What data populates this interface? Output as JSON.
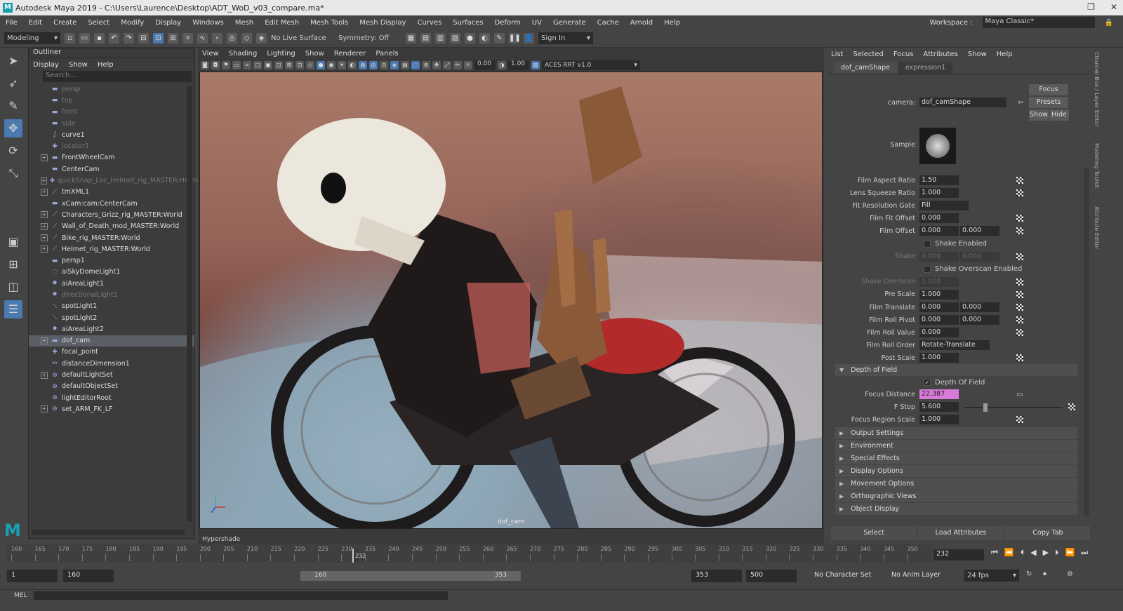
{
  "window": {
    "title": "Autodesk Maya 2019 - C:\\Users\\Laurence\\Desktop\\ADT_WoD_v03_compare.ma*"
  },
  "menu": [
    "File",
    "Edit",
    "Create",
    "Select",
    "Modify",
    "Display",
    "Windows",
    "Mesh",
    "Edit Mesh",
    "Mesh Tools",
    "Mesh Display",
    "Curves",
    "Surfaces",
    "Deform",
    "UV",
    "Generate",
    "Cache",
    "Arnold",
    "Help"
  ],
  "workspace": {
    "label": "Workspace :",
    "value": "Maya Classic*"
  },
  "statusline": {
    "mode": "Modeling",
    "live_surface": "No Live Surface",
    "symmetry": "Symmetry: Off",
    "sign_in": "Sign In"
  },
  "outliner": {
    "title": "Outliner",
    "menu": [
      "Display",
      "Show",
      "Help"
    ],
    "search_placeholder": "Search...",
    "items": [
      {
        "label": "persp",
        "dim": true,
        "exp": false,
        "icon": "camera-icon"
      },
      {
        "label": "top",
        "dim": true,
        "exp": false,
        "icon": "camera-icon"
      },
      {
        "label": "front",
        "dim": true,
        "exp": false,
        "icon": "camera-icon"
      },
      {
        "label": "side",
        "dim": true,
        "exp": false,
        "icon": "camera-icon"
      },
      {
        "label": "curve1",
        "dim": false,
        "exp": false,
        "icon": "curve-icon"
      },
      {
        "label": "locator1",
        "dim": true,
        "exp": false,
        "icon": "locator-icon"
      },
      {
        "label": "FrontWheelCam",
        "dim": false,
        "exp": true,
        "icon": "camera-icon"
      },
      {
        "label": "CenterCam",
        "dim": false,
        "exp": false,
        "icon": "camera-icon"
      },
      {
        "label": "quickSnap_Loc_Helmet_rig_MASTER:Helmet",
        "dim": true,
        "exp": true,
        "icon": "locator-icon"
      },
      {
        "label": "tmXML1",
        "dim": false,
        "exp": true,
        "icon": "joint-icon"
      },
      {
        "label": "xCam:cam:CenterCam",
        "dim": false,
        "exp": false,
        "icon": "camera-icon"
      },
      {
        "label": "Characters_Grizz_rig_MASTER:World",
        "dim": false,
        "exp": true,
        "icon": "joint-icon"
      },
      {
        "label": "Wall_of_Death_mod_MASTER:World",
        "dim": false,
        "exp": true,
        "icon": "joint-icon"
      },
      {
        "label": "Bike_rig_MASTER:World",
        "dim": false,
        "exp": true,
        "icon": "joint-icon"
      },
      {
        "label": "Helmet_rig_MASTER:World",
        "dim": false,
        "exp": true,
        "icon": "joint-icon"
      },
      {
        "label": "persp1",
        "dim": false,
        "exp": false,
        "icon": "camera-icon"
      },
      {
        "label": "aiSkyDomeLight1",
        "dim": false,
        "exp": false,
        "icon": "skydome-icon"
      },
      {
        "label": "aiAreaLight1",
        "dim": false,
        "exp": false,
        "icon": "light-icon"
      },
      {
        "label": "directionalLight1",
        "dim": true,
        "exp": false,
        "icon": "light-icon"
      },
      {
        "label": "spotLight1",
        "dim": false,
        "exp": false,
        "icon": "spotlight-icon"
      },
      {
        "label": "spotLight2",
        "dim": false,
        "exp": false,
        "icon": "spotlight-icon"
      },
      {
        "label": "aiAreaLight2",
        "dim": false,
        "exp": false,
        "icon": "light-icon"
      },
      {
        "label": "dof_cam",
        "dim": false,
        "exp": true,
        "icon": "camera-icon",
        "selected": true
      },
      {
        "label": "focal_point",
        "dim": false,
        "exp": false,
        "icon": "locator-icon"
      },
      {
        "label": "distanceDimension1",
        "dim": false,
        "exp": false,
        "icon": "dimension-icon"
      },
      {
        "label": "defaultLightSet",
        "dim": false,
        "exp": true,
        "icon": "set-icon"
      },
      {
        "label": "defaultObjectSet",
        "dim": false,
        "exp": false,
        "icon": "set-icon"
      },
      {
        "label": "lightEditorRoot",
        "dim": false,
        "exp": false,
        "icon": "set-icon"
      },
      {
        "label": "set_ARM_FK_LF",
        "dim": false,
        "exp": true,
        "icon": "set-icon"
      }
    ]
  },
  "viewport": {
    "menu": [
      "View",
      "Shading",
      "Lighting",
      "Show",
      "Renderer",
      "Panels"
    ],
    "exposure": "0.00",
    "gamma": "1.00",
    "color_space": "ACES RRT v1.0",
    "camera_label": "dof_cam",
    "hypershade": "Hypershade"
  },
  "attribute_editor": {
    "menu": [
      "List",
      "Selected",
      "Focus",
      "Attributes",
      "Show",
      "Help"
    ],
    "tabs": [
      "dof_camShape",
      "expression1"
    ],
    "camera_label": "camera:",
    "camera_value": "dof_camShape",
    "buttons": {
      "focus": "Focus",
      "presets": "Presets",
      "show": "Show",
      "hide": "Hide"
    },
    "sample_label": "Sample",
    "rows": [
      {
        "label": "Film Aspect Ratio",
        "v1": "1.50",
        "v2": null,
        "dim": false
      },
      {
        "label": "Lens Squeeze Ratio",
        "v1": "1.000",
        "v2": null,
        "dim": false
      },
      {
        "label": "Fit Resolution Gate",
        "v1": "Fill",
        "v2": null,
        "dim": false,
        "dropdown": true
      },
      {
        "label": "Film Fit Offset",
        "v1": "0.000",
        "v2": null,
        "dim": false
      },
      {
        "label": "Film Offset",
        "v1": "0.000",
        "v2": "0.000",
        "dim": false
      },
      {
        "label": "",
        "check": "Shake Enabled",
        "checked": false
      },
      {
        "label": "Shake",
        "v1": "0.000",
        "v2": "0.000",
        "dim": true
      },
      {
        "label": "",
        "check": "Shake Overscan Enabled",
        "checked": false
      },
      {
        "label": "Shake Overscan",
        "v1": "1.000",
        "v2": null,
        "dim": true
      },
      {
        "label": "Pre Scale",
        "v1": "1.000",
        "v2": null,
        "dim": false
      },
      {
        "label": "Film Translate",
        "v1": "0.000",
        "v2": "0.000",
        "dim": false
      },
      {
        "label": "Film Roll Pivot",
        "v1": "0.000",
        "v2": "0.000",
        "dim": false
      },
      {
        "label": "Film Roll Value",
        "v1": "0.000",
        "v2": null,
        "dim": false
      },
      {
        "label": "Film Roll Order",
        "v1": "Rotate-Translate",
        "v2": null,
        "dim": false,
        "dropdown": true
      },
      {
        "label": "Post Scale",
        "v1": "1.000",
        "v2": null,
        "dim": false
      }
    ],
    "dof": {
      "section": "Depth of Field",
      "check": "Depth Of Field",
      "focus_distance_label": "Focus Distance",
      "focus_distance": "22.387",
      "fstop_label": "F Stop",
      "fstop": "5.600",
      "fstop_slider": 0.2,
      "region_label": "Focus Region Scale",
      "region": "1.000"
    },
    "sections": [
      "Output Settings",
      "Environment",
      "Special Effects",
      "Display Options",
      "Movement Options",
      "Orthographic Views",
      "Object Display"
    ],
    "bottom_buttons": [
      "Select",
      "Load Attributes",
      "Copy Tab"
    ]
  },
  "right_strip": [
    "Channel Box / Layer Editor",
    "Modeling Toolkit",
    "Attribute Editor"
  ],
  "timeline": {
    "ticks": [
      "160",
      "165",
      "170",
      "175",
      "180",
      "185",
      "190",
      "195",
      "200",
      "205",
      "210",
      "215",
      "220",
      "225",
      "230",
      "235",
      "240",
      "245",
      "250",
      "255",
      "260",
      "265",
      "270",
      "275",
      "280",
      "285",
      "290",
      "295",
      "300",
      "305",
      "310",
      "315",
      "320",
      "325",
      "330",
      "335",
      "340",
      "345",
      "350"
    ],
    "current": "232",
    "current_frame_field": "232"
  },
  "range": {
    "start": "1",
    "playback_start": "160",
    "bar_start": "160",
    "bar_end": "353",
    "playback_end": "353",
    "end": "500",
    "character_set": "No Character Set",
    "anim_layer": "No Anim Layer",
    "fps": "24 fps"
  },
  "cmdline": {
    "label": "MEL"
  }
}
